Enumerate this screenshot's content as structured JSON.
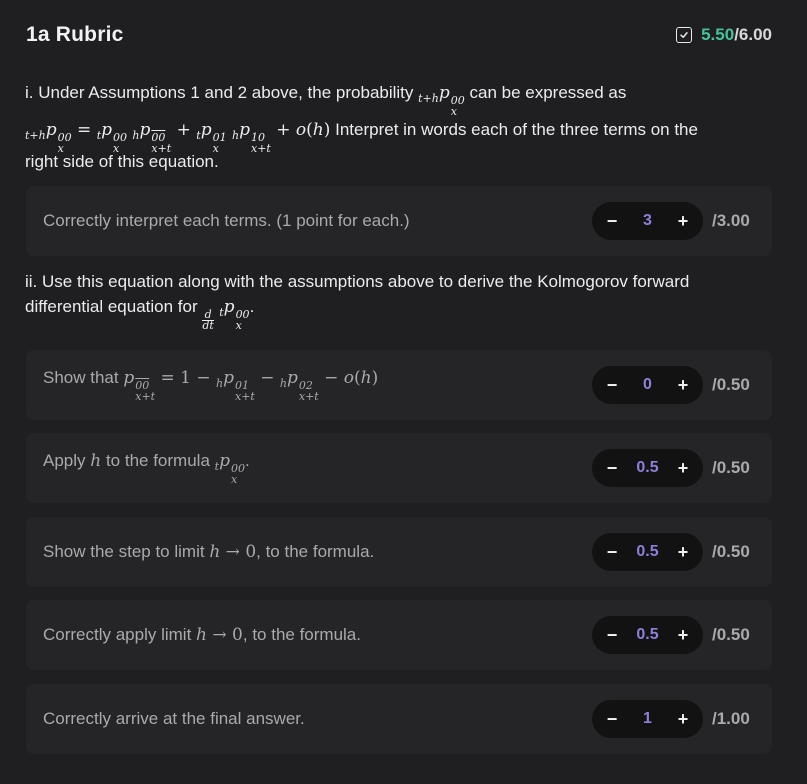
{
  "header": {
    "title": "1a Rubric",
    "score_awarded": "5.50",
    "score_total": "/6.00"
  },
  "question_i": {
    "line1_prefix": "i. Under Assumptions 1 and 2 above, the probability",
    "line1_suffix": "can be expressed as",
    "line2_suffix": "Interpret in words each of the three terms on the",
    "line3": "right side of this equation."
  },
  "question_ii": {
    "line1": "ii. Use this equation along with the assumptions above to derive the Kolmogorov forward",
    "line2_prefix": "differential equation for"
  },
  "criteria": [
    {
      "label": "Correctly interpret each terms. (1 point for each.)",
      "value": "3",
      "max": "/3.00"
    },
    {
      "label_prefix": "Show that",
      "value": "0",
      "max": "/0.50"
    },
    {
      "label_prefix": "Apply",
      "label_mid": "to the formula",
      "value": "0.5",
      "max": "/0.50"
    },
    {
      "label_prefix": "Show the step to limit",
      "label_suffix": ", to the formula.",
      "value": "0.5",
      "max": "/0.50"
    },
    {
      "label_prefix": "Correctly apply limit",
      "label_suffix": ", to the formula.",
      "value": "0.5",
      "max": "/0.50"
    },
    {
      "label": "Correctly arrive at the final answer.",
      "value": "1",
      "max": "/1.00"
    }
  ],
  "stepper": {
    "minus": "−",
    "plus": "+"
  },
  "icons": {
    "score": "checkbox-check-icon"
  },
  "colors": {
    "accent_green": "#46c29a",
    "accent_purple": "#8f7fd8",
    "background": "#1f1f21"
  }
}
